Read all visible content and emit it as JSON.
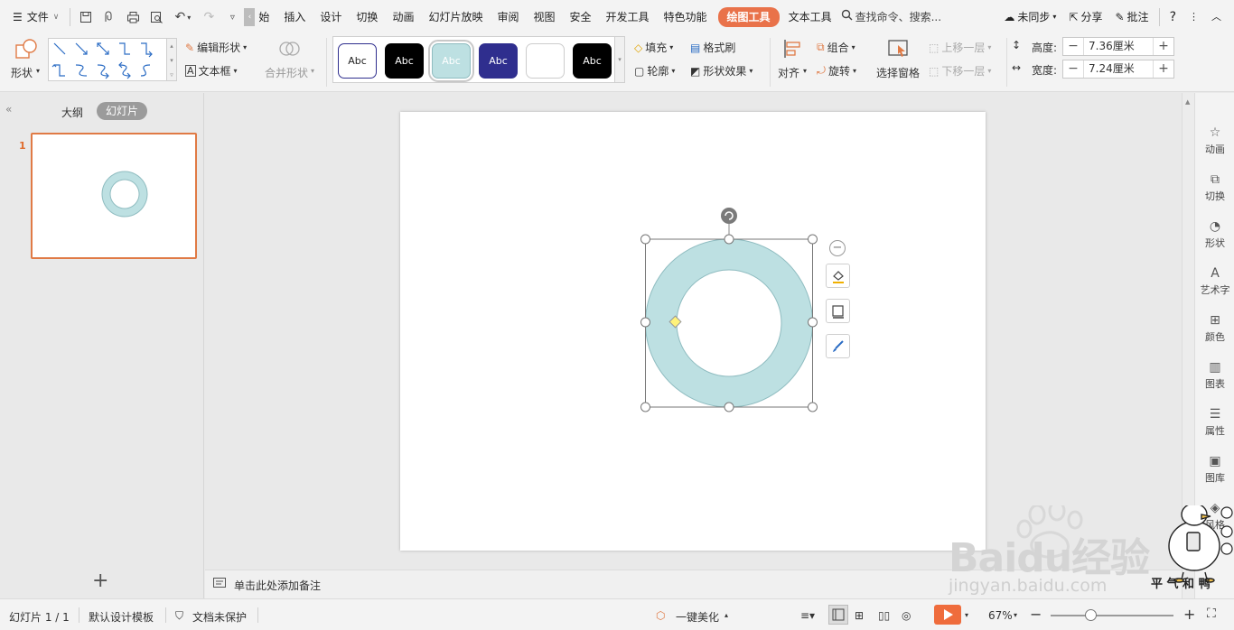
{
  "menubar": {
    "file_label": "文件",
    "tabs": [
      "始",
      "插入",
      "设计",
      "切换",
      "动画",
      "幻灯片放映",
      "审阅",
      "视图",
      "安全",
      "开发工具",
      "特色功能",
      "绘图工具",
      "文本工具"
    ],
    "active_tab": "绘图工具",
    "search_label": "查找命令、搜索...",
    "sync_label": "未同步",
    "share_label": "分享",
    "comment_label": "批注",
    "help_label": "?"
  },
  "ribbon": {
    "shape_label": "形状",
    "edit_shape_label": "编辑形状",
    "textbox_label": "文本框",
    "merge_shape_label": "合并形状",
    "style_chip_text": "Abc",
    "fill_label": "填充",
    "format_painter_label": "格式刷",
    "outline_label": "轮廓",
    "shape_effect_label": "形状效果",
    "align_label": "对齐",
    "group_label": "组合",
    "rotate_label": "旋转",
    "selection_pane_label": "选择窗格",
    "bring_forward_label": "上移一层",
    "send_backward_label": "下移一层",
    "height_label": "高度:",
    "height_value": "7.36厘米",
    "width_label": "宽度:",
    "width_value": "7.24厘米"
  },
  "leftpanel": {
    "outline_tab": "大纲",
    "slides_tab": "幻灯片",
    "slide_number": "1"
  },
  "notes": {
    "placeholder": "单击此处添加备注"
  },
  "rsidebar": {
    "items": [
      "动画",
      "切换",
      "形状",
      "艺术字",
      "颜色",
      "图表",
      "属性",
      "图库",
      "风格"
    ]
  },
  "statusbar": {
    "slide_counter": "幻灯片 1 / 1",
    "template_label": "默认设计模板",
    "protect_label": "文档未保护",
    "beautify_label": "一键美化",
    "zoom_label": "67%"
  },
  "watermark": {
    "brand": "Baidu经验",
    "url": "jingyan.baidu.com",
    "corner_text": "平 气 和 鸭"
  },
  "colors": {
    "accent": "#e9724a",
    "donut_fill": "#bde0e2",
    "donut_stroke": "#8fbcc0",
    "style_navy": "#2f2e8e",
    "play_button": "#ef6c3c"
  }
}
